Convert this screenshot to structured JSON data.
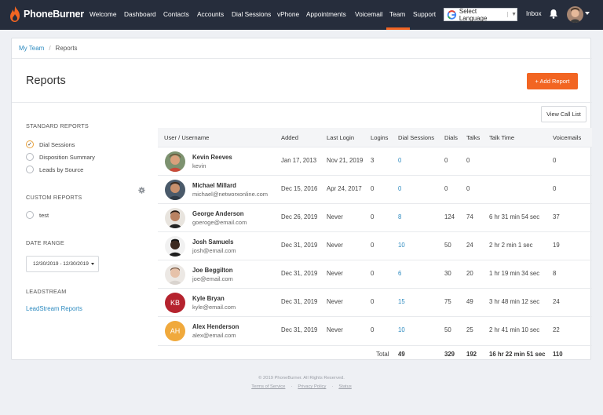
{
  "nav": {
    "logo": "PhoneBurner",
    "items": [
      "Welcome",
      "Dashboard",
      "Contacts",
      "Accounts",
      "Dial Sessions",
      "vPhone",
      "Appointments",
      "Voicemail",
      "Team",
      "Support"
    ],
    "active": "Team",
    "language": "Select Language",
    "inbox": "Inbox",
    "accent_color": "#f06423",
    "bar_color": "#262d3c"
  },
  "breadcrumb": {
    "parent": "My Team",
    "separator": "/",
    "current": "Reports"
  },
  "page": {
    "title": "Reports",
    "add_button": "+ Add Report",
    "view_call_list": "View Call List"
  },
  "sidebar": {
    "standard_heading": "STANDARD REPORTS",
    "standard_items": [
      {
        "label": "Dial Sessions",
        "checked": true
      },
      {
        "label": "Disposition Summary",
        "checked": false
      },
      {
        "label": "Leads by Source",
        "checked": false
      }
    ],
    "custom_heading": "CUSTOM REPORTS",
    "custom_items": [
      {
        "label": "test",
        "checked": false
      }
    ],
    "date_heading": "DATE RANGE",
    "date_value": "12/30/2019 - 12/30/2019",
    "leadstream_heading": "LEADSTREAM",
    "leadstream_link": "LeadStream Reports"
  },
  "table": {
    "headers": {
      "user": "User / Username",
      "added": "Added",
      "last_login": "Last Login",
      "logins": "Logins",
      "dial_sessions": "Dial Sessions",
      "dials": "Dials",
      "talks": "Talks",
      "talk_time": "Talk Time",
      "voicemails": "Voicemails"
    },
    "rows": [
      {
        "name": "Kevin Reeves",
        "username": "kevin",
        "added": "Jan 17, 2013",
        "last_login": "Nov 21, 2019",
        "logins": "3",
        "dial_sessions": "0",
        "dials": "0",
        "talks": "0",
        "talk_time": "",
        "voicemails": "0",
        "initials": "",
        "avatar_color": "#8b5a3c"
      },
      {
        "name": "Michael Millard",
        "username": "michael@networxonline.com",
        "added": "Dec 15, 2016",
        "last_login": "Apr 24, 2017",
        "logins": "0",
        "dial_sessions": "0",
        "dials": "0",
        "talks": "0",
        "talk_time": "",
        "voicemails": "0",
        "initials": "",
        "avatar_color": "#a0674a"
      },
      {
        "name": "George Anderson",
        "username": "goeroge@email.com",
        "added": "Dec 26, 2019",
        "last_login": "Never",
        "logins": "0",
        "dial_sessions": "8",
        "dials": "124",
        "talks": "74",
        "talk_time": "6 hr 31 min 54 sec",
        "voicemails": "37",
        "initials": "",
        "avatar_color": "#b07a5c"
      },
      {
        "name": "Josh Samuels",
        "username": "josh@email.com",
        "added": "Dec 31, 2019",
        "last_login": "Never",
        "logins": "0",
        "dial_sessions": "10",
        "dials": "50",
        "talks": "24",
        "talk_time": "2 hr 2 min 1 sec",
        "voicemails": "19",
        "initials": "",
        "avatar_color": "#3b2a22"
      },
      {
        "name": "Joe Beggilton",
        "username": "joe@email.com",
        "added": "Dec 31, 2019",
        "last_login": "Never",
        "logins": "0",
        "dial_sessions": "6",
        "dials": "30",
        "talks": "20",
        "talk_time": "1 hr 19 min 34 sec",
        "voicemails": "8",
        "initials": "",
        "avatar_color": "#d9b8a4"
      },
      {
        "name": "Kyle Bryan",
        "username": "kyle@email.com",
        "added": "Dec 31, 2019",
        "last_login": "Never",
        "logins": "0",
        "dial_sessions": "15",
        "dials": "75",
        "talks": "49",
        "talk_time": "3 hr 48 min 12 sec",
        "voicemails": "24",
        "initials": "KB",
        "avatar_color": "#b5232e"
      },
      {
        "name": "Alex Henderson",
        "username": "alex@email.com",
        "added": "Dec 31, 2019",
        "last_login": "Never",
        "logins": "0",
        "dial_sessions": "10",
        "dials": "50",
        "talks": "25",
        "talk_time": "2 hr 41 min 10 sec",
        "voicemails": "22",
        "initials": "AH",
        "avatar_color": "#f0a93c"
      }
    ],
    "totals": {
      "label": "Total",
      "dial_sessions": "49",
      "dials": "329",
      "talks": "192",
      "talk_time": "16 hr 22 min 51 sec",
      "voicemails": "110"
    }
  },
  "footer": {
    "copyright": "© 2019 PhoneBurner. All Rights Reserved.",
    "links": [
      "Terms of Service",
      "Privacy Policy",
      "Status"
    ],
    "separator": "·"
  }
}
